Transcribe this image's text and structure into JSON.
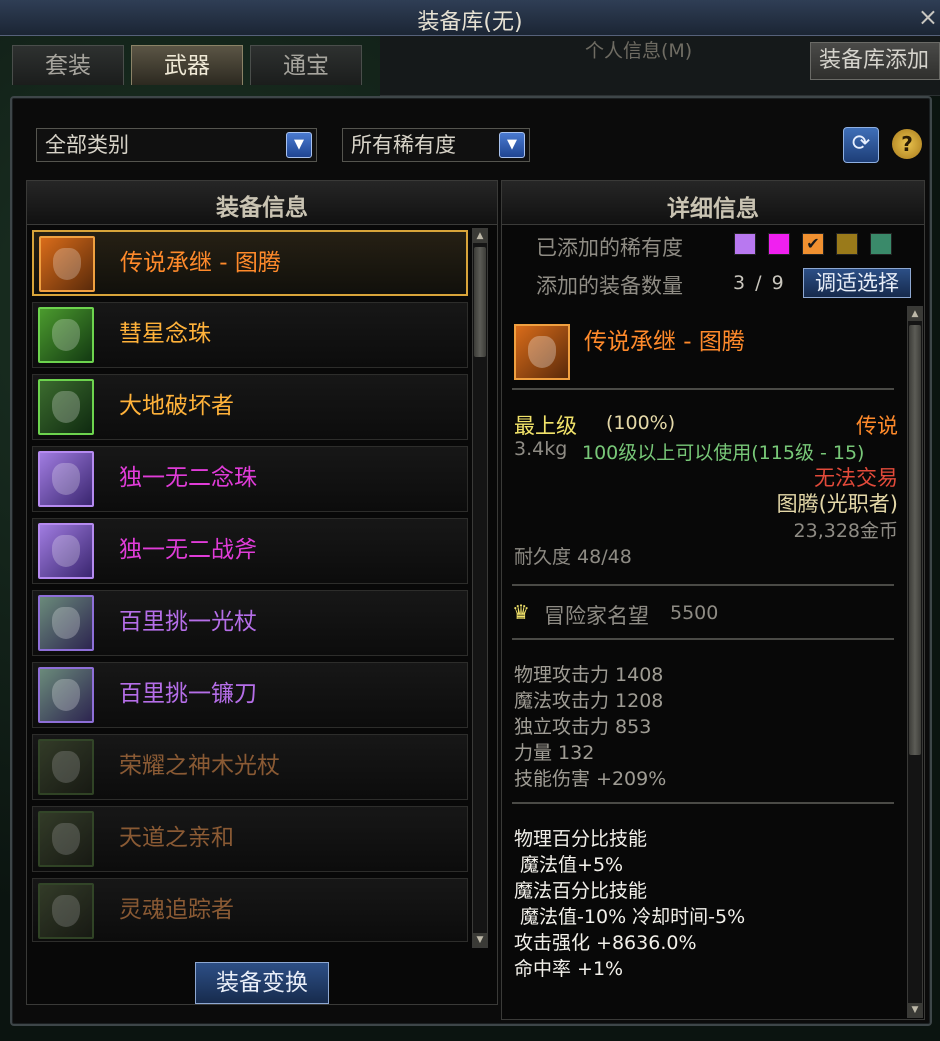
{
  "window": {
    "title": "装备库(无)",
    "close": "×"
  },
  "background": {
    "panel_title": "个人信息(M)",
    "add_button": "装备库添加"
  },
  "tabs": [
    {
      "label": "套装",
      "active": false
    },
    {
      "label": "武器",
      "active": true
    },
    {
      "label": "通宝",
      "active": false
    }
  ],
  "filters": {
    "category": "全部类别",
    "rarity": "所有稀有度"
  },
  "icons": {
    "refresh": "refresh-icon",
    "help": "?",
    "dropdown": "▼"
  },
  "left_panel": {
    "header": "装备信息",
    "items": [
      {
        "name": "传说承继 - 图腾",
        "rarity": "legendary",
        "selected": true
      },
      {
        "name": "彗星念珠",
        "rarity": "epic"
      },
      {
        "name": "大地破坏者",
        "rarity": "epic"
      },
      {
        "name": "独一无二念珠",
        "rarity": "unique"
      },
      {
        "name": "独一无二战斧",
        "rarity": "unique"
      },
      {
        "name": "百里挑一光杖",
        "rarity": "rare"
      },
      {
        "name": "百里挑一镰刀",
        "rarity": "rare"
      },
      {
        "name": "荣耀之神木光杖",
        "rarity": "dimmed"
      },
      {
        "name": "天道之亲和",
        "rarity": "dimmed"
      },
      {
        "name": "灵魂追踪者",
        "rarity": "dimmed"
      }
    ],
    "swap_button": "装备变换"
  },
  "right_panel": {
    "header": "详细信息",
    "added_rarity_label": "已添加的稀有度",
    "rarity_swatches": [
      "#b878f0",
      "#f020f0",
      "#f09030",
      "#9a7a1a",
      "#3a8a6a"
    ],
    "added_count_label": "添加的装备数量",
    "added_count": "3 / 9",
    "adjust_button": "调适选择",
    "detail": {
      "name": "传说承继 - 图腾",
      "grade": "最上级",
      "grade_pct": "(100%)",
      "rarity_text": "传说",
      "weight": "3.4kg",
      "level_req": "100级以上可以使用(115级 - 15)",
      "trade": "无法交易",
      "type": "图腾(光职者)",
      "price": "23,328金币",
      "durability": "耐久度 48/48",
      "fame_label": "冒险家名望",
      "fame_value": "5500",
      "stats": [
        "物理攻击力 1408",
        "魔法攻击力 1208",
        "独立攻击力 853",
        "力量 132",
        "技能伤害 +209%"
      ],
      "effects": [
        "物理百分比技能",
        " 魔法值+5%",
        "魔法百分比技能",
        " 魔法值-10% 冷却时间-5%",
        "攻击强化 +8636.0%",
        "命中率 +1%"
      ]
    }
  }
}
